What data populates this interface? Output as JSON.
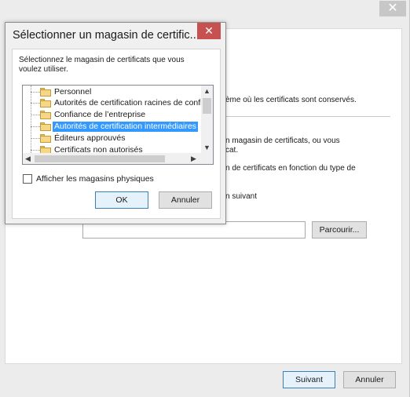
{
  "wizard": {
    "close_glyph": "✕",
    "text_line1": "ème où les certificats sont conservés.",
    "text_line2": "n magasin de certificats, ou vous",
    "text_line3": "cat.",
    "text_line4": "n de certificats en fonction du type de",
    "text_line5": "n suivant",
    "path_value": "",
    "browse_label": "Parcourir...",
    "next_label": "Suivant",
    "cancel_label": "Annuler"
  },
  "dialog": {
    "title": "Sélectionner un magasin de certific...",
    "close_glyph": "✕",
    "instruction": "Sélectionnez le magasin de certificats que vous voulez utiliser.",
    "tree_items": [
      {
        "label": "Personnel",
        "selected": false
      },
      {
        "label": "Autorités de certification racines de confiance",
        "selected": false
      },
      {
        "label": "Confiance de l’entreprise",
        "selected": false
      },
      {
        "label": "Autorités de certification intermédiaires",
        "selected": true
      },
      {
        "label": "Éditeurs approuvés",
        "selected": false
      },
      {
        "label": "Certificats non autorisés",
        "selected": false
      }
    ],
    "checkbox_label": "Afficher les magasins physiques",
    "checkbox_checked": false,
    "ok_label": "OK",
    "cancel_label": "Annuler"
  },
  "colors": {
    "selection": "#3399ff",
    "dialog_close": "#c75050",
    "default_button_border": "#3c7fb1"
  }
}
